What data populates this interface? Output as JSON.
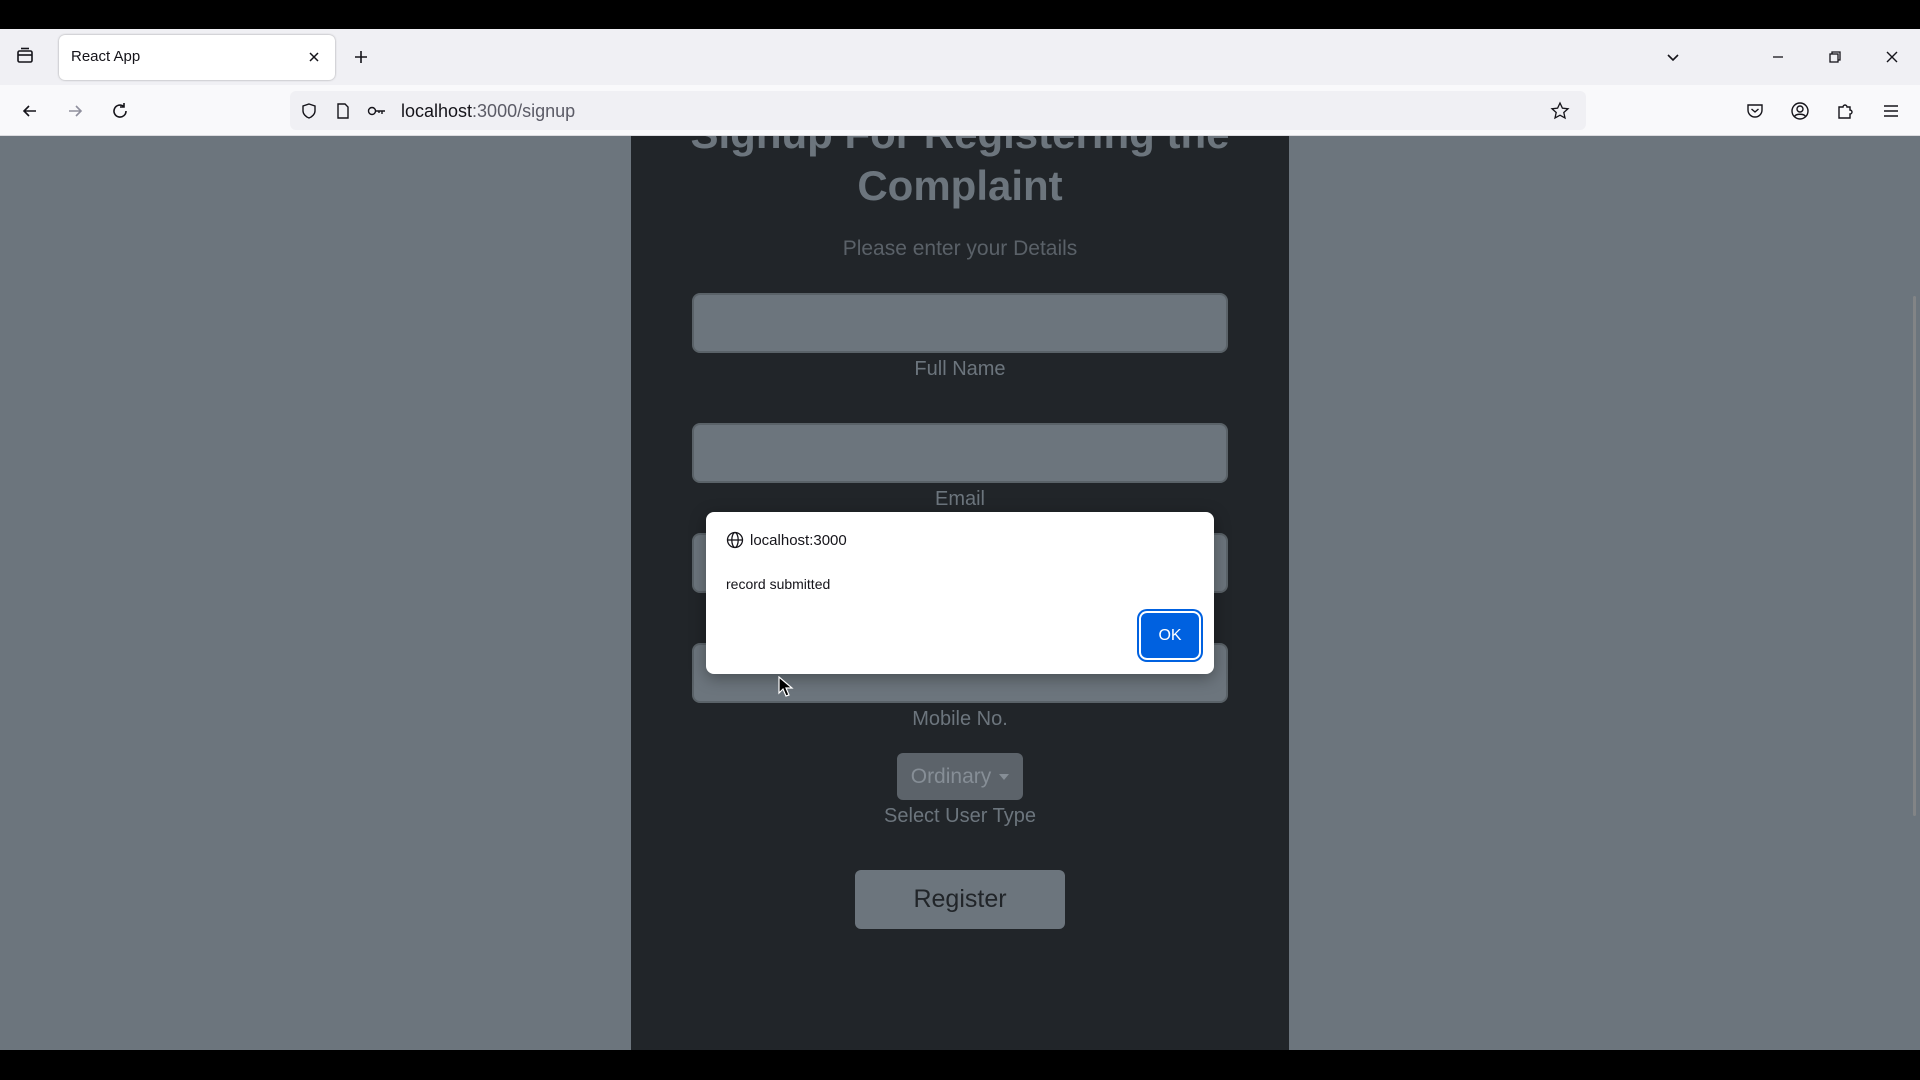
{
  "browser": {
    "tab_title": "React App",
    "url_host": "localhost",
    "url_path": ":3000/signup"
  },
  "page": {
    "title": "Signup For Registering the Complaint",
    "subtitle": "Please enter your Details",
    "labels": {
      "full_name": "Full Name",
      "email": "Email",
      "mobile": "Mobile No.",
      "user_type": "Select User Type"
    },
    "user_type_selected": "Ordinary",
    "register_label": "Register"
  },
  "alert": {
    "origin": "localhost:3000",
    "message": "record submitted",
    "ok_label": "OK"
  },
  "colors": {
    "page_bg": "#6c757d",
    "card_bg": "#212529",
    "ok_button": "#0061e0"
  }
}
